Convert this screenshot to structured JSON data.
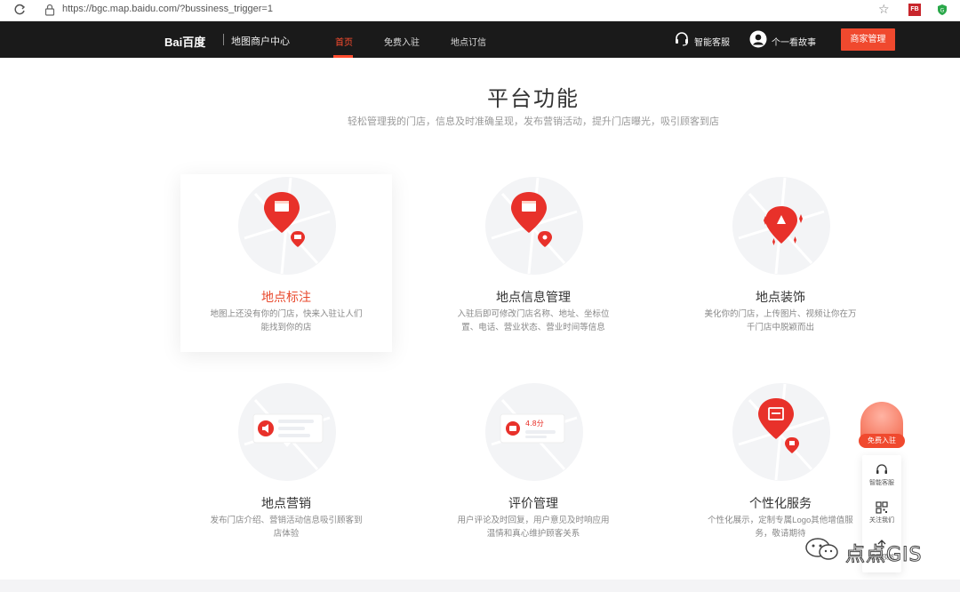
{
  "browser": {
    "url": "https://bgc.map.baidu.com/?bussiness_trigger=1",
    "ext_badge": "FB"
  },
  "header": {
    "logo": "Bai百度",
    "logo_sub": "地图商户中心",
    "nav": [
      {
        "label": "首页",
        "active": true
      },
      {
        "label": "免费入驻",
        "active": false
      },
      {
        "label": "地点订信",
        "active": false
      }
    ],
    "service_label": "智能客服",
    "user_name": "个一看故事",
    "merchant_button": "商家管理",
    "accent_color": "#f0492e"
  },
  "main": {
    "title": "平台功能",
    "subtitle": "轻松管理我的门店，信息及时准确呈现，发布营销活动，提升门店曝光，吸引顾客到店",
    "features": [
      {
        "name": "地点标注",
        "desc": "地图上还没有你的门店，快来入驻让人们能找到你的店",
        "icon": "store-pin-icon",
        "active": true
      },
      {
        "name": "地点信息管理",
        "desc": "入驻后即可修改门店名称、地址、坐标位置、电话、营业状态、营业时间等信息",
        "icon": "store-info-pin-icon",
        "active": false
      },
      {
        "name": "地点装饰",
        "desc": "美化你的门店，上传图片、视频让你在万千门店中脱颖而出",
        "icon": "decorate-pin-icon",
        "active": false
      },
      {
        "name": "地点营销",
        "desc": "发布门店介绍、营销活动信息吸引顾客到店体验",
        "icon": "marketing-icon",
        "active": false
      },
      {
        "name": "评价管理",
        "desc": "用户评论及时回复，用户意见及时响应用温情和真心维护顾客关系",
        "icon": "review-icon",
        "rating": "4.8分",
        "active": false
      },
      {
        "name": "个性化服务",
        "desc": "个性化展示，定制专属Logo其他增值服务，敬请期待",
        "icon": "custom-service-pin-icon",
        "active": false
      }
    ]
  },
  "float": {
    "join_label": "免费入驻",
    "items": [
      {
        "label": "智能客服",
        "icon": "headset-icon"
      },
      {
        "label": "关注我们",
        "icon": "qr-code-icon"
      },
      {
        "label": "返回顶部",
        "icon": "arrow-up-icon"
      }
    ]
  },
  "watermark": "点点GIS"
}
